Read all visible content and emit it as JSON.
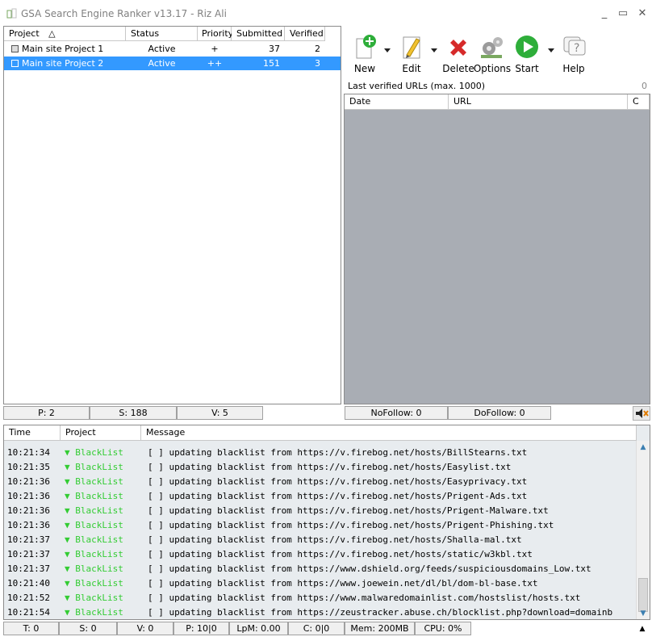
{
  "window": {
    "title": "GSA Search Engine Ranker v13.17 - Riz Ali",
    "minimize": "_",
    "maximize": "▭",
    "close": "✕"
  },
  "projects": {
    "columns": [
      "Project",
      "Status",
      "Priority",
      "Submitted",
      "Verified"
    ],
    "sort_indicator": "△",
    "rows": [
      {
        "name": "Main site Project 1",
        "status": "Active",
        "priority": "+",
        "submitted": "37",
        "verified": "2",
        "selected": false
      },
      {
        "name": "Main site Project 2",
        "status": "Active",
        "priority": "++",
        "submitted": "151",
        "verified": "3",
        "selected": true
      }
    ],
    "summary": {
      "projects": "P: 2",
      "submitted": "S: 188",
      "verified": "V: 5"
    }
  },
  "toolbar": {
    "new": "New",
    "edit": "Edit",
    "delete": "Delete",
    "options": "Options",
    "start": "Start",
    "help": "Help"
  },
  "urls": {
    "label": "Last verified URLs (max. 1000)",
    "count": "0",
    "columns": [
      "Date",
      "URL",
      "C"
    ],
    "nofollow": "NoFollow:  0",
    "dofollow": "DoFollow: 0"
  },
  "log": {
    "columns": [
      "Time",
      "Project",
      "Message"
    ],
    "rows": [
      {
        "time": "10:21:34",
        "project": "▼ BlackList",
        "message": "[ ] updating blacklist from https://v.firebog.net/hosts/BillStearns.txt"
      },
      {
        "time": "10:21:35",
        "project": "▼ BlackList",
        "message": "[ ] updating blacklist from https://v.firebog.net/hosts/Easylist.txt"
      },
      {
        "time": "10:21:36",
        "project": "▼ BlackList",
        "message": "[ ] updating blacklist from https://v.firebog.net/hosts/Easyprivacy.txt"
      },
      {
        "time": "10:21:36",
        "project": "▼ BlackList",
        "message": "[ ] updating blacklist from https://v.firebog.net/hosts/Prigent-Ads.txt"
      },
      {
        "time": "10:21:36",
        "project": "▼ BlackList",
        "message": "[ ] updating blacklist from https://v.firebog.net/hosts/Prigent-Malware.txt"
      },
      {
        "time": "10:21:36",
        "project": "▼ BlackList",
        "message": "[ ] updating blacklist from https://v.firebog.net/hosts/Prigent-Phishing.txt"
      },
      {
        "time": "10:21:37",
        "project": "▼ BlackList",
        "message": "[ ] updating blacklist from https://v.firebog.net/hosts/Shalla-mal.txt"
      },
      {
        "time": "10:21:37",
        "project": "▼ BlackList",
        "message": "[ ] updating blacklist from https://v.firebog.net/hosts/static/w3kbl.txt"
      },
      {
        "time": "10:21:37",
        "project": "▼ BlackList",
        "message": "[ ] updating blacklist from https://www.dshield.org/feeds/suspiciousdomains_Low.txt"
      },
      {
        "time": "10:21:40",
        "project": "▼ BlackList",
        "message": "[ ] updating blacklist from https://www.joewein.net/dl/bl/dom-bl-base.txt"
      },
      {
        "time": "10:21:52",
        "project": "▼ BlackList",
        "message": "[ ] updating blacklist from https://www.malwaredomainlist.com/hostslist/hosts.txt"
      },
      {
        "time": "10:21:54",
        "project": "▼ BlackList",
        "message": "[ ] updating blacklist from https://zeustracker.abuse.ch/blocklist.php?download=domainb"
      }
    ]
  },
  "stats": {
    "threads": "T: 0",
    "submitted": "S: 0",
    "verified": "V: 0",
    "proxies": "P: 10|0",
    "lpm": "LpM: 0.00",
    "captcha": "C: 0|0",
    "memory": "Mem: 200MB",
    "cpu": "CPU: 0%"
  }
}
